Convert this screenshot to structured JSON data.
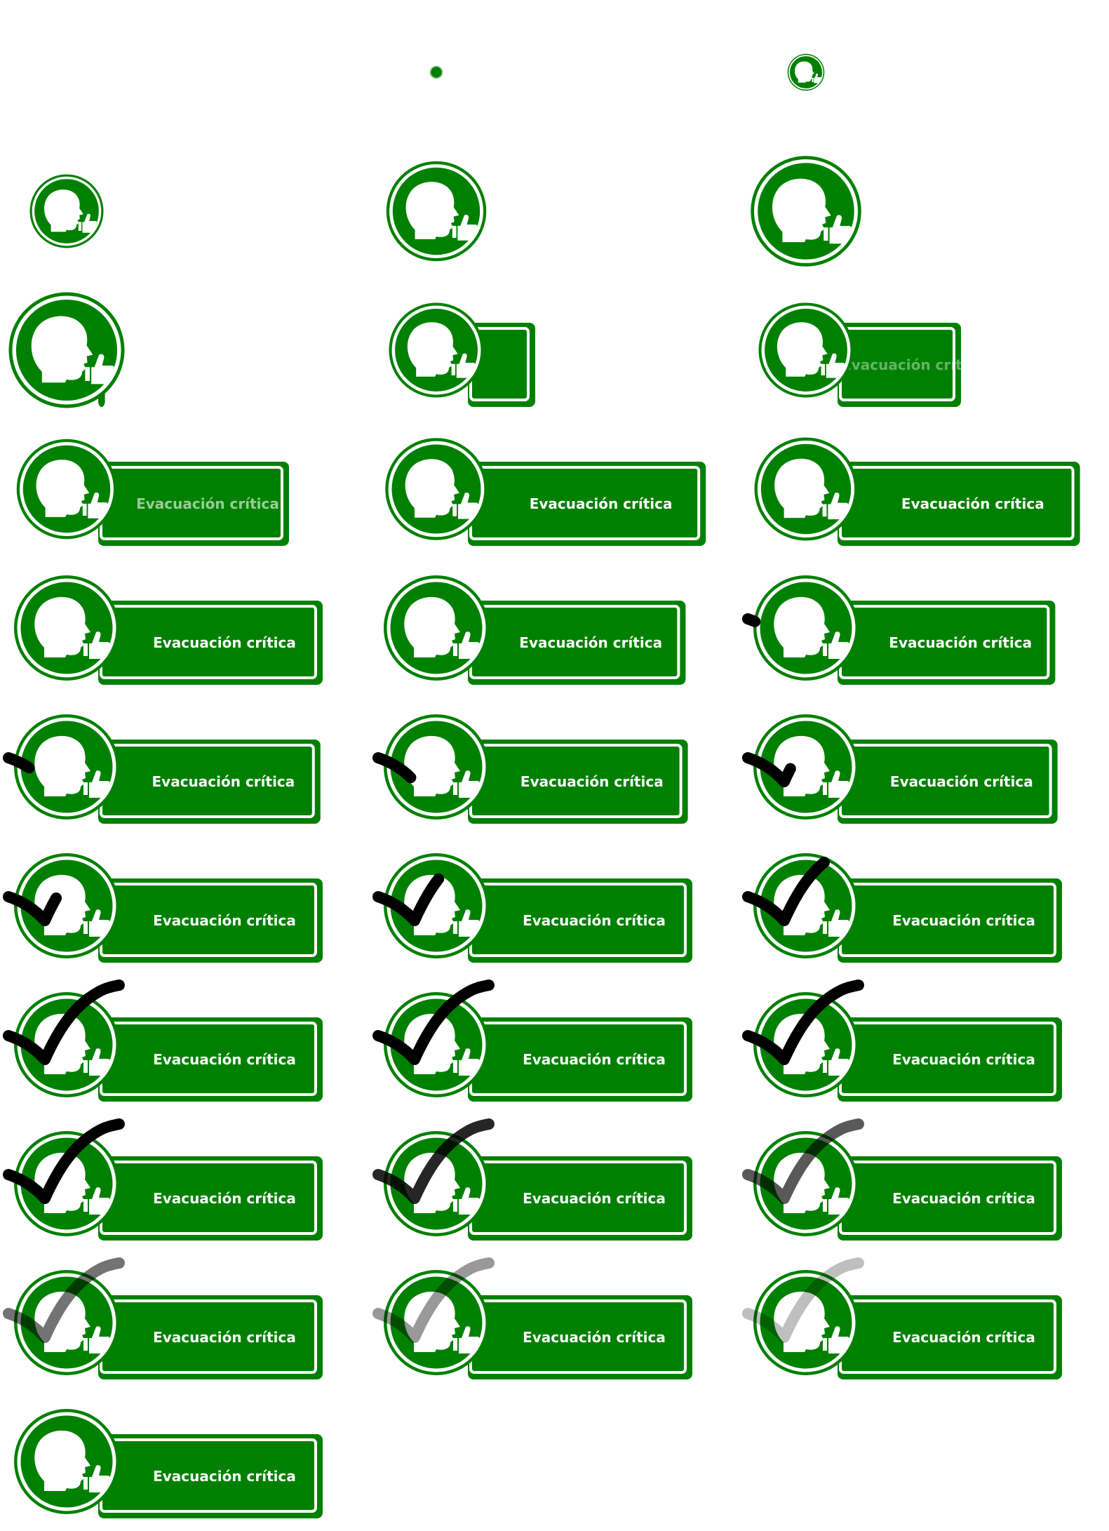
{
  "badge": {
    "label": "Evacuación crítica",
    "colors": {
      "green": "#008000",
      "white": "#ffffff",
      "check": "#000000"
    },
    "icons": {
      "head": "head-profile-icon",
      "thumb": "thumbs-up-icon",
      "check": "checkmark-icon"
    }
  },
  "frames": [
    {
      "step": 1,
      "circle": 0.0,
      "banner": 0.0,
      "text": 0.0,
      "check": 0.0,
      "check_opacity": 0
    },
    {
      "step": 2,
      "circle": 0.12,
      "banner": 0.0,
      "text": 0.0,
      "check": 0.0,
      "check_opacity": 0
    },
    {
      "step": 3,
      "circle": 0.35,
      "banner": 0.0,
      "text": 0.0,
      "check": 0.0,
      "check_opacity": 0
    },
    {
      "step": 4,
      "circle": 0.7,
      "banner": 0.0,
      "text": 0.0,
      "check": 0.0,
      "check_opacity": 0
    },
    {
      "step": 5,
      "circle": 0.95,
      "banner": 0.0,
      "text": 0.0,
      "check": 0.0,
      "check_opacity": 0
    },
    {
      "step": 6,
      "circle": 1.05,
      "banner": 0.0,
      "text": 0.0,
      "check": 0.0,
      "check_opacity": 0
    },
    {
      "step": 7,
      "circle": 1.1,
      "banner": 0.03,
      "text": 0.0,
      "check": 0.0,
      "check_opacity": 0
    },
    {
      "step": 8,
      "circle": 0.9,
      "banner": 0.3,
      "text": 0.0,
      "check": 0.0,
      "check_opacity": 0
    },
    {
      "step": 9,
      "circle": 0.9,
      "banner": 0.55,
      "text": 0.4,
      "check": 0.0,
      "check_opacity": 0
    },
    {
      "step": 10,
      "circle": 0.95,
      "banner": 0.85,
      "text": 0.6,
      "check": 0.0,
      "check_opacity": 0
    },
    {
      "step": 11,
      "circle": 0.97,
      "banner": 1.06,
      "text": 1.0,
      "check": 0.0,
      "check_opacity": 0
    },
    {
      "step": 12,
      "circle": 0.98,
      "banner": 1.08,
      "text": 1.0,
      "check": 0.0,
      "check_opacity": 0
    },
    {
      "step": 13,
      "circle": 1.0,
      "banner": 1.0,
      "text": 1.0,
      "check": 0.0,
      "check_opacity": 0
    },
    {
      "step": 14,
      "circle": 1.0,
      "banner": 0.97,
      "text": 1.0,
      "check": 0.0,
      "check_opacity": 0
    },
    {
      "step": 15,
      "circle": 1.0,
      "banner": 0.97,
      "text": 1.0,
      "check": 0.05,
      "check_opacity": 1
    },
    {
      "step": 16,
      "circle": 1.0,
      "banner": 0.99,
      "text": 1.0,
      "check": 0.15,
      "check_opacity": 1
    },
    {
      "step": 17,
      "circle": 1.0,
      "banner": 0.98,
      "text": 1.0,
      "check": 0.25,
      "check_opacity": 1
    },
    {
      "step": 18,
      "circle": 1.0,
      "banner": 0.98,
      "text": 1.0,
      "check": 0.38,
      "check_opacity": 1
    },
    {
      "step": 19,
      "circle": 1.0,
      "banner": 1.0,
      "text": 1.0,
      "check": 0.45,
      "check_opacity": 1
    },
    {
      "step": 20,
      "circle": 1.0,
      "banner": 1.0,
      "text": 1.0,
      "check": 0.6,
      "check_opacity": 1
    },
    {
      "step": 21,
      "circle": 1.0,
      "banner": 1.0,
      "text": 1.0,
      "check": 0.75,
      "check_opacity": 1
    },
    {
      "step": 22,
      "circle": 1.0,
      "banner": 1.0,
      "text": 1.0,
      "check": 1.0,
      "check_opacity": 1
    },
    {
      "step": 23,
      "circle": 1.0,
      "banner": 1.0,
      "text": 1.0,
      "check": 1.0,
      "check_opacity": 1
    },
    {
      "step": 24,
      "circle": 1.0,
      "banner": 1.0,
      "text": 1.0,
      "check": 1.0,
      "check_opacity": 1
    },
    {
      "step": 25,
      "circle": 1.0,
      "banner": 1.0,
      "text": 1.0,
      "check": 1.0,
      "check_opacity": 1
    },
    {
      "step": 26,
      "circle": 1.0,
      "banner": 1.0,
      "text": 1.0,
      "check": 1.0,
      "check_opacity": 0.85
    },
    {
      "step": 27,
      "circle": 1.0,
      "banner": 1.0,
      "text": 1.0,
      "check": 1.0,
      "check_opacity": 0.65
    },
    {
      "step": 28,
      "circle": 1.0,
      "banner": 1.0,
      "text": 1.0,
      "check": 1.0,
      "check_opacity": 0.55
    },
    {
      "step": 29,
      "circle": 1.0,
      "banner": 1.0,
      "text": 1.0,
      "check": 1.0,
      "check_opacity": 0.4
    },
    {
      "step": 30,
      "circle": 1.0,
      "banner": 1.0,
      "text": 1.0,
      "check": 1.0,
      "check_opacity": 0.25
    },
    {
      "step": 31,
      "circle": 1.0,
      "banner": 1.0,
      "text": 1.0,
      "check": 0.0,
      "check_opacity": 0
    }
  ]
}
